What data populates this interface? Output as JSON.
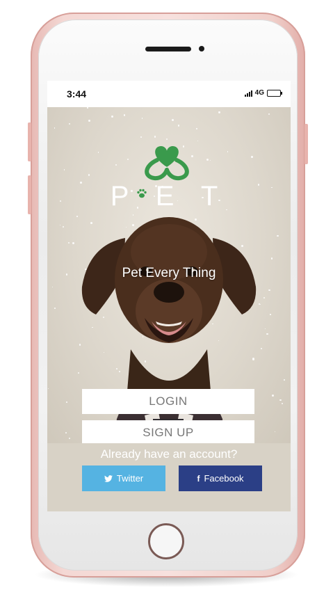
{
  "status_bar": {
    "time": "3:44",
    "network": "4G"
  },
  "app": {
    "logo_text": "P E T",
    "tagline": "Pet Every Thing",
    "login_label": "LOGIN",
    "signup_label": "SIGN UP",
    "account_prompt": "Already have an account?",
    "twitter_label": "Twitter",
    "facebook_label": "Facebook"
  },
  "icons": {
    "twitter": "twitter-bird-icon",
    "facebook": "facebook-f-icon",
    "logo": "heart-logo-icon",
    "paw": "paw-icon"
  },
  "colors": {
    "logo_green": "#3a9a4c",
    "twitter_blue": "#55b3e2",
    "facebook_blue": "#2b3f86",
    "phone_rose_gold": "#f4d8d4"
  }
}
